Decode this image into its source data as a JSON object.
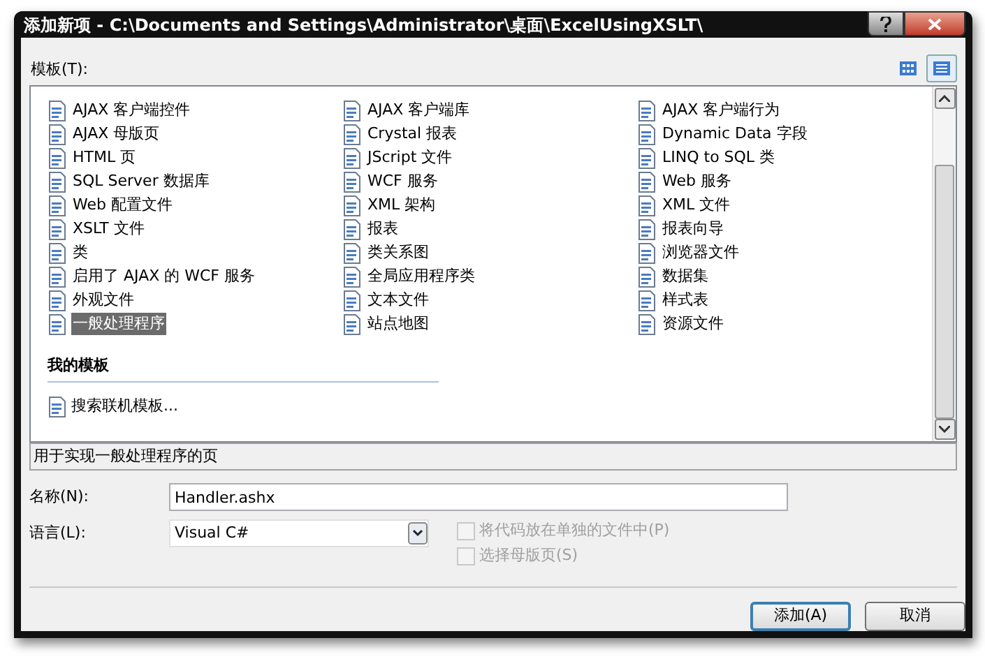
{
  "window": {
    "title": "添加新项 - C:\\Documents and Settings\\Administrator\\桌面\\ExcelUsingXSLT\\"
  },
  "templates_label": "模板(T):",
  "view_buttons": [
    {
      "kind": "icons",
      "selected": false
    },
    {
      "kind": "list",
      "selected": true
    }
  ],
  "templates": [
    {
      "label": "AJAX 客户端控件",
      "selected": false
    },
    {
      "label": "AJAX 客户端库",
      "selected": false
    },
    {
      "label": "AJAX 客户端行为",
      "selected": false
    },
    {
      "label": "AJAX 母版页",
      "selected": false
    },
    {
      "label": "Crystal 报表",
      "selected": false
    },
    {
      "label": "Dynamic Data 字段",
      "selected": false
    },
    {
      "label": "HTML 页",
      "selected": false
    },
    {
      "label": "JScript 文件",
      "selected": false
    },
    {
      "label": "LINQ to SQL 类",
      "selected": false
    },
    {
      "label": "SQL Server 数据库",
      "selected": false
    },
    {
      "label": "WCF 服务",
      "selected": false
    },
    {
      "label": "Web 服务",
      "selected": false
    },
    {
      "label": "Web 配置文件",
      "selected": false
    },
    {
      "label": "XML 架构",
      "selected": false
    },
    {
      "label": "XML 文件",
      "selected": false
    },
    {
      "label": "XSLT 文件",
      "selected": false
    },
    {
      "label": "报表",
      "selected": false
    },
    {
      "label": "报表向导",
      "selected": false
    },
    {
      "label": "类",
      "selected": false
    },
    {
      "label": "类关系图",
      "selected": false
    },
    {
      "label": "浏览器文件",
      "selected": false
    },
    {
      "label": "启用了 AJAX 的 WCF 服务",
      "selected": false
    },
    {
      "label": "全局应用程序类",
      "selected": false
    },
    {
      "label": "数据集",
      "selected": false
    },
    {
      "label": "外观文件",
      "selected": false
    },
    {
      "label": "文本文件",
      "selected": false
    },
    {
      "label": "样式表",
      "selected": false
    },
    {
      "label": "一般处理程序",
      "selected": true
    },
    {
      "label": "站点地图",
      "selected": false
    },
    {
      "label": "资源文件",
      "selected": false
    }
  ],
  "my_templates": {
    "heading": "我的模板",
    "items": [
      {
        "label": "搜索联机模板..."
      }
    ]
  },
  "description": "用于实现一般处理程序的页",
  "name_field": {
    "label": "名称(N):",
    "value": "Handler.ashx"
  },
  "language_field": {
    "label": "语言(L):",
    "value": "Visual C#"
  },
  "options": [
    {
      "label": "将代码放在单独的文件中(P)",
      "checked": false,
      "disabled": true
    },
    {
      "label": "选择母版页(S)",
      "checked": false,
      "disabled": true
    }
  ],
  "buttons": [
    {
      "label": "添加(A)",
      "default": true
    },
    {
      "label": "取消",
      "default": false
    }
  ]
}
